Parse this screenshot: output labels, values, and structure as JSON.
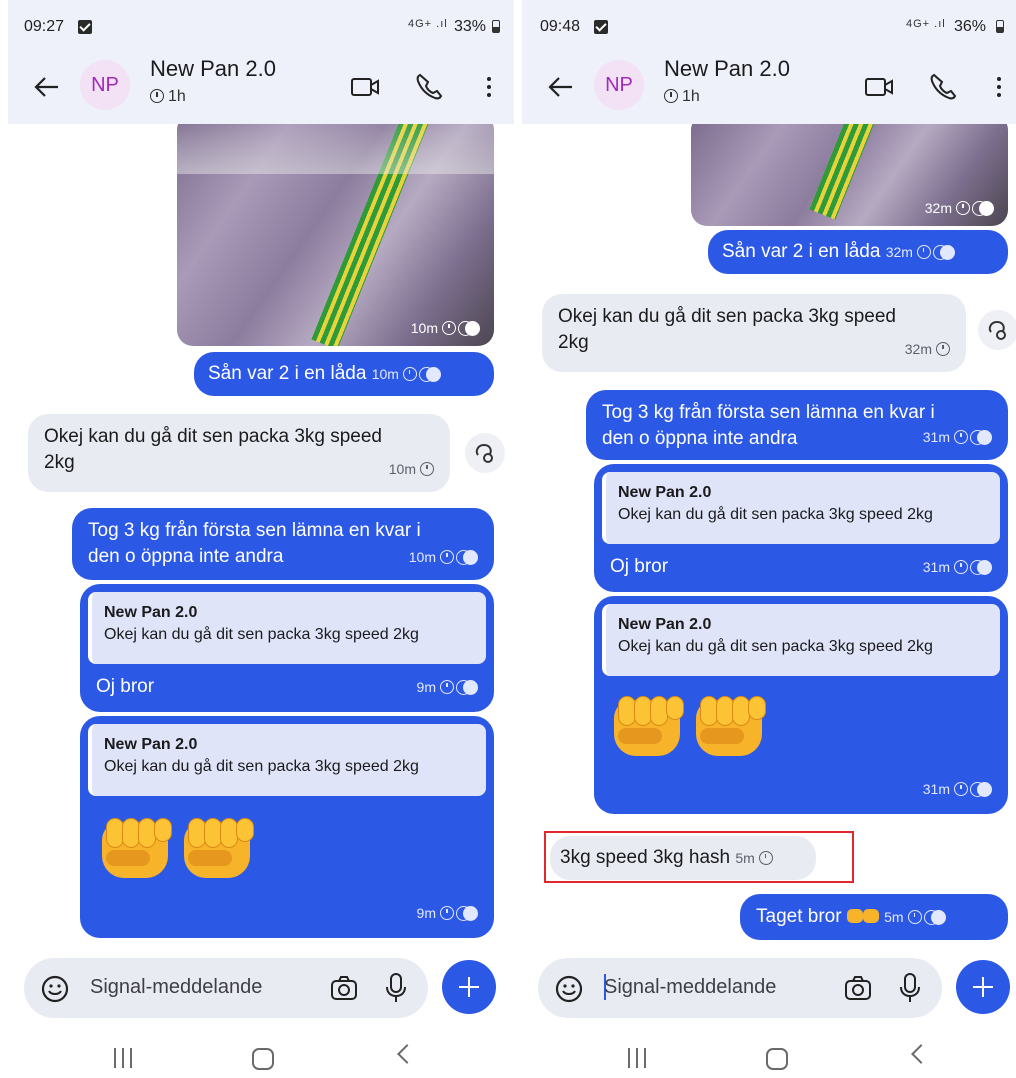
{
  "left": {
    "status": {
      "time": "09:27",
      "network": "4G+ .ıl",
      "battery": "33%"
    },
    "header": {
      "avatar": "NP",
      "title": "New Pan 2.0",
      "timer": "1h"
    },
    "image_time": "10m",
    "msg_san": {
      "text": "Sån var 2 i en låda",
      "time": "10m"
    },
    "msg_okej": {
      "line1": "Okej kan du gå dit sen packa 3kg speed",
      "line2": "2kg",
      "time": "10m"
    },
    "msg_tog": {
      "line1": "Tog 3 kg från första sen lämna en kvar i",
      "line2": "den o öppna inte andra",
      "time": "10m"
    },
    "msg_oj": {
      "quote_author": "New Pan 2.0",
      "quote_text": "Okej kan du gå dit sen packa 3kg speed 2kg",
      "text": "Oj bror",
      "time": "9m"
    },
    "msg_fist": {
      "quote_author": "New Pan 2.0",
      "quote_text": "Okej kan du gå dit sen packa 3kg speed 2kg",
      "time": "9m"
    },
    "composer": {
      "placeholder": "Signal-meddelande"
    }
  },
  "right": {
    "status": {
      "time": "09:48",
      "network": "4G+ .ıl",
      "battery": "36%"
    },
    "header": {
      "avatar": "NP",
      "title": "New Pan 2.0",
      "timer": "1h"
    },
    "image_time": "32m",
    "msg_san": {
      "text": "Sån var 2 i en låda",
      "time": "32m"
    },
    "msg_okej": {
      "line1": "Okej kan du gå dit sen packa 3kg speed",
      "line2": "2kg",
      "time": "32m"
    },
    "msg_tog": {
      "line1": "Tog 3 kg från första sen lämna en kvar i",
      "line2": "den o öppna inte andra",
      "time": "31m"
    },
    "msg_oj": {
      "quote_author": "New Pan 2.0",
      "quote_text": "Okej kan du gå dit sen packa 3kg speed 2kg",
      "text": "Oj bror",
      "time": "31m"
    },
    "msg_fist": {
      "quote_author": "New Pan 2.0",
      "quote_text": "Okej kan du gå dit sen packa 3kg speed 2kg",
      "time": "31m"
    },
    "msg_hash": {
      "text": "3kg speed 3kg hash",
      "time": "5m"
    },
    "msg_taget": {
      "text": "Taget bror",
      "time": "5m"
    },
    "composer": {
      "placeholder": "Signal-meddelande"
    }
  },
  "colors": {
    "accent": "#2c58e6",
    "incoming": "#e9ebf3",
    "header": "#eef0fa",
    "highlight": "#e0282e"
  }
}
